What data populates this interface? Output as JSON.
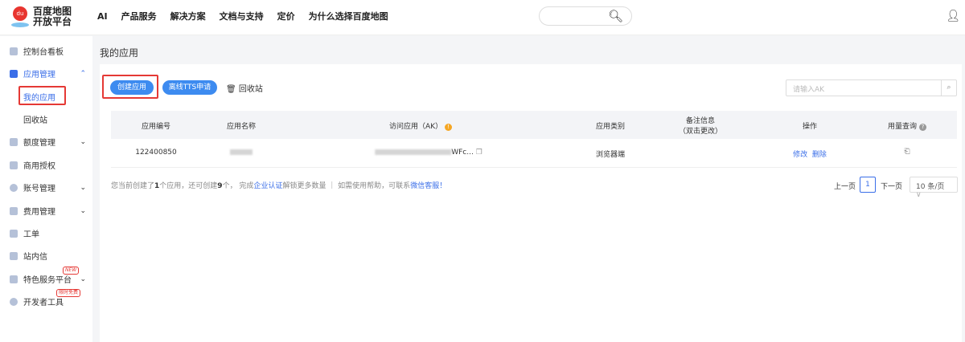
{
  "header": {
    "logo_line1": "百度地图",
    "logo_line2": "开放平台",
    "logo_badge": "du",
    "nav": [
      "AI",
      "产品服务",
      "解决方案",
      "文档与支持",
      "定价",
      "为什么选择百度地图"
    ]
  },
  "sidebar": {
    "items": [
      {
        "label": "控制台看板"
      },
      {
        "label": "应用管理"
      },
      {
        "label": "额度管理"
      },
      {
        "label": "商用授权"
      },
      {
        "label": "账号管理"
      },
      {
        "label": "费用管理"
      },
      {
        "label": "工单"
      },
      {
        "label": "站内信"
      },
      {
        "label": "特色服务平台",
        "badge": "NEW"
      },
      {
        "label": "开发者工具",
        "badge": "限时免费"
      }
    ],
    "sub_items": [
      "我的应用",
      "回收站"
    ]
  },
  "page": {
    "title": "我的应用",
    "create_btn": "创建应用",
    "tts_btn": "离线TTS申请",
    "recycle": "回收站",
    "search_placeholder": "请输入AK"
  },
  "table": {
    "headers": [
      "应用编号",
      "应用名称",
      "访问应用（AK）",
      "应用类别",
      "备注信息",
      "（双击更改）",
      "操作",
      "用量查询"
    ],
    "rows": [
      {
        "id": "122400850",
        "ak_suffix": "WFc...",
        "category": "浏览器端",
        "edit": "修改",
        "delete": "删除"
      }
    ]
  },
  "info": {
    "t1": "您当前创建了",
    "n1": "1",
    "t2": "个应用，还可创建",
    "n2": "9",
    "t3": "个， 完成",
    "link1": "企业认证",
    "t4": "解锁更多数量 ｜ 如需使用帮助，可联系",
    "link2": "微信客服！"
  },
  "pagination": {
    "prev": "上一页",
    "current": "1",
    "next": "下一页",
    "page_size": "10 条/页"
  },
  "colors": {
    "accent": "#3a6ee8",
    "button": "#3d8bf0",
    "highlight": "#e53935"
  }
}
